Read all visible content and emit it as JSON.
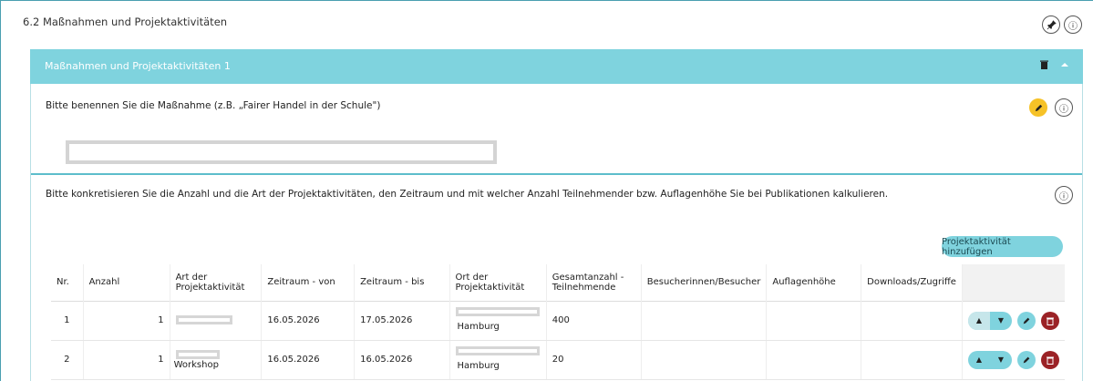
{
  "section": {
    "title": "6.2 Maßnahmen und Projektaktivitäten",
    "info_icon": "info-icon",
    "pin_icon": "pin-icon"
  },
  "panel": {
    "title": "Maßnahmen und Projektaktivitäten 1",
    "trash_icon": "trash-icon",
    "collapse_icon": "chevron-up-icon"
  },
  "question1": {
    "label": "Bitte benennen Sie die Maßnahme (z.B. „Fairer Handel in der Schule\")",
    "value": ""
  },
  "question2": {
    "label": "Bitte konkretisieren Sie die Anzahl und die Art der Projektaktivitäten, den Zeitraum und mit welcher Anzahl Teilnehmender bzw. Auflagenhöhe Sie bei Publikationen kalkulieren."
  },
  "add_button": "Projektaktivität hinzufügen",
  "table": {
    "headers": [
      "Nr.",
      "Anzahl",
      "Art der Projektaktivität",
      "Zeitraum - von",
      "Zeitraum - bis",
      "Ort der Projektaktivität",
      "Gesamtanzahl - Teilnehmende",
      "Besucherinnen/Besucher",
      "Auflagenhöhe",
      "Downloads/Zugriffe"
    ],
    "rows": [
      {
        "nr": "1",
        "anzahl": "1",
        "art": "",
        "von": "16.05.2026",
        "bis": "17.05.2026",
        "ort": "Hamburg",
        "teilnehmende": "400",
        "besucher": "",
        "auflage": "",
        "downloads": ""
      },
      {
        "nr": "2",
        "anzahl": "1",
        "art": "Workshop",
        "von": "16.05.2026",
        "bis": "16.05.2026",
        "ort": "Hamburg",
        "teilnehmende": "20",
        "besucher": "",
        "auflage": "",
        "downloads": ""
      }
    ]
  },
  "colors": {
    "accent": "#7fd3de",
    "danger": "#9b2226",
    "edit_highlight": "#f6c227"
  }
}
